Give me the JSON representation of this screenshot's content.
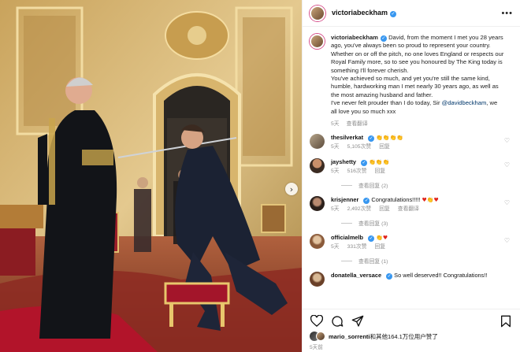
{
  "post": {
    "username": "victoriabeckham",
    "more_icon": "more-horizontal-icon"
  },
  "caption": {
    "username": "victoriabeckham",
    "text_before_mention": "David, from the moment I met you 28 years ago, you've always been so proud to represent your country. Whether on or off the pitch, no one loves England or respects our Royal Family more, so to see you honoured by The King today is something I'll forever cherish.\nYou've achieved so much, and yet you're still the same kind, humble, hardworking man I met nearly 30 years ago, as well as the most amazing husband and father.\nI've never felt prouder than I do today, Sir ",
    "mention": "@davidbeckham",
    "text_after_mention": ", we all love you so much xxx",
    "time": "5天",
    "translate": "查看翻译"
  },
  "comments": [
    {
      "username": "thesilverkat",
      "text": "",
      "emoji": "👏👏👏👏",
      "emoji_color": "clap",
      "time": "5天",
      "likes": "5,105次赞",
      "reply": "回复",
      "translate": "",
      "replies": ""
    },
    {
      "username": "jayshetty",
      "text": "",
      "emoji": "👏👏👏",
      "emoji_color": "clap",
      "time": "5天",
      "likes": "516次赞",
      "reply": "回复",
      "translate": "",
      "replies": "查看回复 (2)"
    },
    {
      "username": "krisjenner",
      "text": "Congratulations!!!!! ",
      "emoji": "♥👏♥",
      "emoji_color": "red",
      "time": "5天",
      "likes": "2,492次赞",
      "reply": "回复",
      "translate": "查看翻译",
      "replies": "查看回复 (3)"
    },
    {
      "username": "officialmelb",
      "text": "",
      "emoji": "👏♥",
      "emoji_color": "red",
      "time": "5天",
      "likes": "331次赞",
      "reply": "回复",
      "translate": "",
      "replies": "查看回复 (1)"
    },
    {
      "username": "donatella_versace",
      "text": "So well deserved!! Congratulations!!",
      "emoji": "",
      "emoji_color": "",
      "time": "",
      "likes": "",
      "reply": "",
      "translate": "",
      "replies": ""
    }
  ],
  "actions": {
    "icons": [
      "heart-icon",
      "comment-icon",
      "share-icon",
      "bookmark-icon"
    ]
  },
  "likes": {
    "user": "mario_sorrenti",
    "rest": "和其他164.1万位用户赞了"
  },
  "date": "5天前",
  "colors": {
    "verified": "#3897f0",
    "mention": "#00376b",
    "meta": "#8e8e8e",
    "heart_red": "#e0241c"
  }
}
